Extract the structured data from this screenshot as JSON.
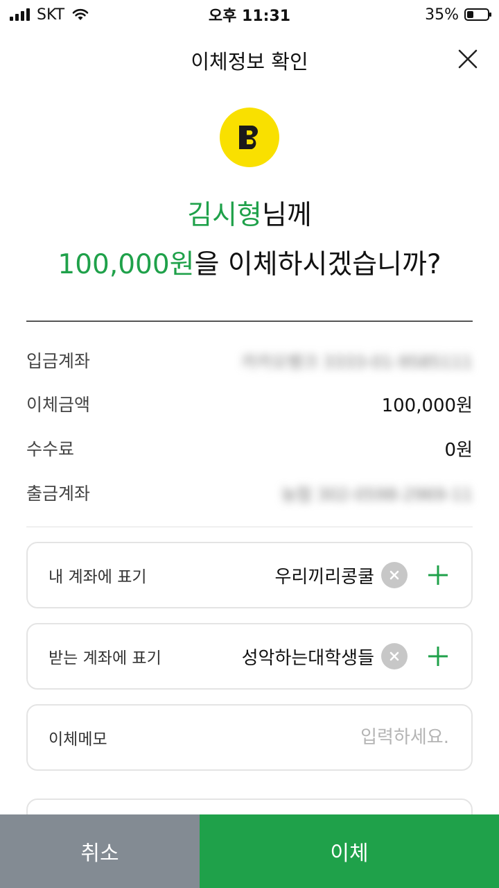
{
  "status_bar": {
    "carrier": "SKT",
    "time": "오후 11:31",
    "battery_percent": "35%",
    "icons": [
      "signal-icon",
      "wifi-icon",
      "battery-icon"
    ]
  },
  "header": {
    "title": "이체정보 확인",
    "close_icon": "close-icon"
  },
  "logo": {
    "letter": "B",
    "color": "#f9e000"
  },
  "headline": {
    "recipient": "김시형",
    "recipient_suffix": "님께",
    "amount": "100,000원",
    "question_suffix": "을 이체하시겠습니까?"
  },
  "details": [
    {
      "label": "입금계좌",
      "value": "카카오뱅크 3333-01-9585111",
      "blurred": true
    },
    {
      "label": "이체금액",
      "value": "100,000원",
      "blurred": false
    },
    {
      "label": "수수료",
      "value": "0원",
      "blurred": false
    },
    {
      "label": "출금계좌",
      "value": "농협 302-0598-2969-11",
      "blurred": true
    }
  ],
  "fields": {
    "my_account_memo": {
      "label": "내 계좌에 표기",
      "value": "우리끼리콩쿨"
    },
    "recipient_memo": {
      "label": "받는 계좌에 표기",
      "value": "성악하는대학생들"
    },
    "transfer_memo": {
      "label": "이체메모",
      "placeholder": "입력하세요."
    }
  },
  "buttons": {
    "cancel": "취소",
    "transfer": "이체"
  },
  "colors": {
    "accent_green": "#1fa14a",
    "cancel_gray": "#838b93",
    "logo_yellow": "#f9e000"
  }
}
